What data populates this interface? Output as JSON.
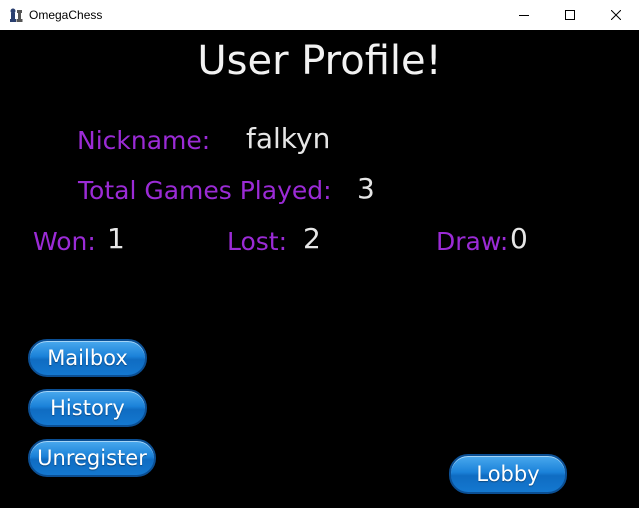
{
  "window": {
    "title": "OmegaChess",
    "icon": "chess-pieces-icon",
    "controls": [
      "minimize-icon",
      "maximize-icon",
      "close-icon"
    ]
  },
  "profile": {
    "heading": "User Profile!",
    "nickname_label": "Nickname:",
    "nickname_value": "falkyn",
    "total_label": "Total Games Played:",
    "total_value": "3",
    "won_label": "Won:",
    "won_value": "1",
    "lost_label": "Lost:",
    "lost_value": "2",
    "draw_label": "Draw:",
    "draw_value": "0"
  },
  "buttons": {
    "mailbox": "Mailbox",
    "history": "History",
    "unregister": "Unregister",
    "lobby": "Lobby"
  },
  "colors": {
    "background": "#000000",
    "label": "#9b2bd6",
    "value": "#e6e6e6",
    "button": "#1b82d9"
  }
}
